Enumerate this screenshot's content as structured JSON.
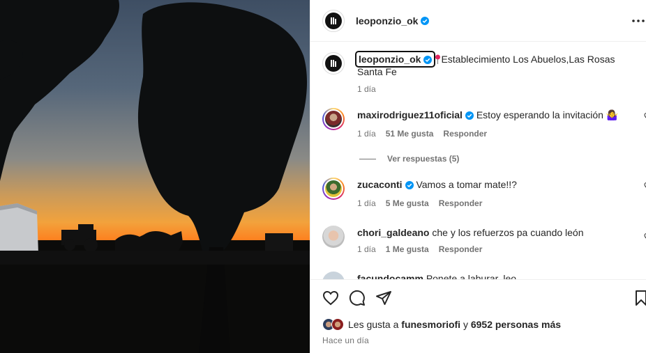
{
  "post": {
    "author": "leoponzio_ok",
    "verified": true
  },
  "caption": {
    "author": "leoponzio_ok",
    "text": "Establecimiento Los Abuelos,Las Rosas Santa Fe",
    "time": "1 día"
  },
  "comments": [
    {
      "user": "maxirodriguez11oficial",
      "verified": true,
      "text": "Estoy esperando la invitación 🤷‍♀️",
      "time": "1 día",
      "likes": "51 Me gusta",
      "reply": "Responder"
    },
    {
      "user": "zucaconti",
      "verified": true,
      "text": "Vamos a tomar mate!!?",
      "time": "1 día",
      "likes": "5 Me gusta",
      "reply": "Responder"
    },
    {
      "user": "chori_galdeano",
      "verified": false,
      "text": "che y los refuerzos pa cuando león",
      "time": "1 día",
      "likes": "1 Me gusta",
      "reply": "Responder"
    },
    {
      "user": "facundocamm",
      "verified": false,
      "text": "Ponete a laburar, leo",
      "time": "",
      "likes": "",
      "reply": ""
    }
  ],
  "view_replies": "Ver respuestas (5)",
  "likes_line": {
    "prefix": "Les gusta a ",
    "user": "funesmoriofi",
    "middle": " y ",
    "others": "6952 personas más"
  },
  "timestamp": "Hace un día",
  "icons": {
    "more": "more-horizontal-icon",
    "like": "heart-icon",
    "comment": "comment-icon",
    "share": "share-icon",
    "save": "bookmark-icon",
    "verified": "verified-badge-icon",
    "location": "location-pin-icon"
  },
  "colors": {
    "verified": "#0095f6",
    "secondary_text": "#737373",
    "primary_text": "#262626"
  }
}
